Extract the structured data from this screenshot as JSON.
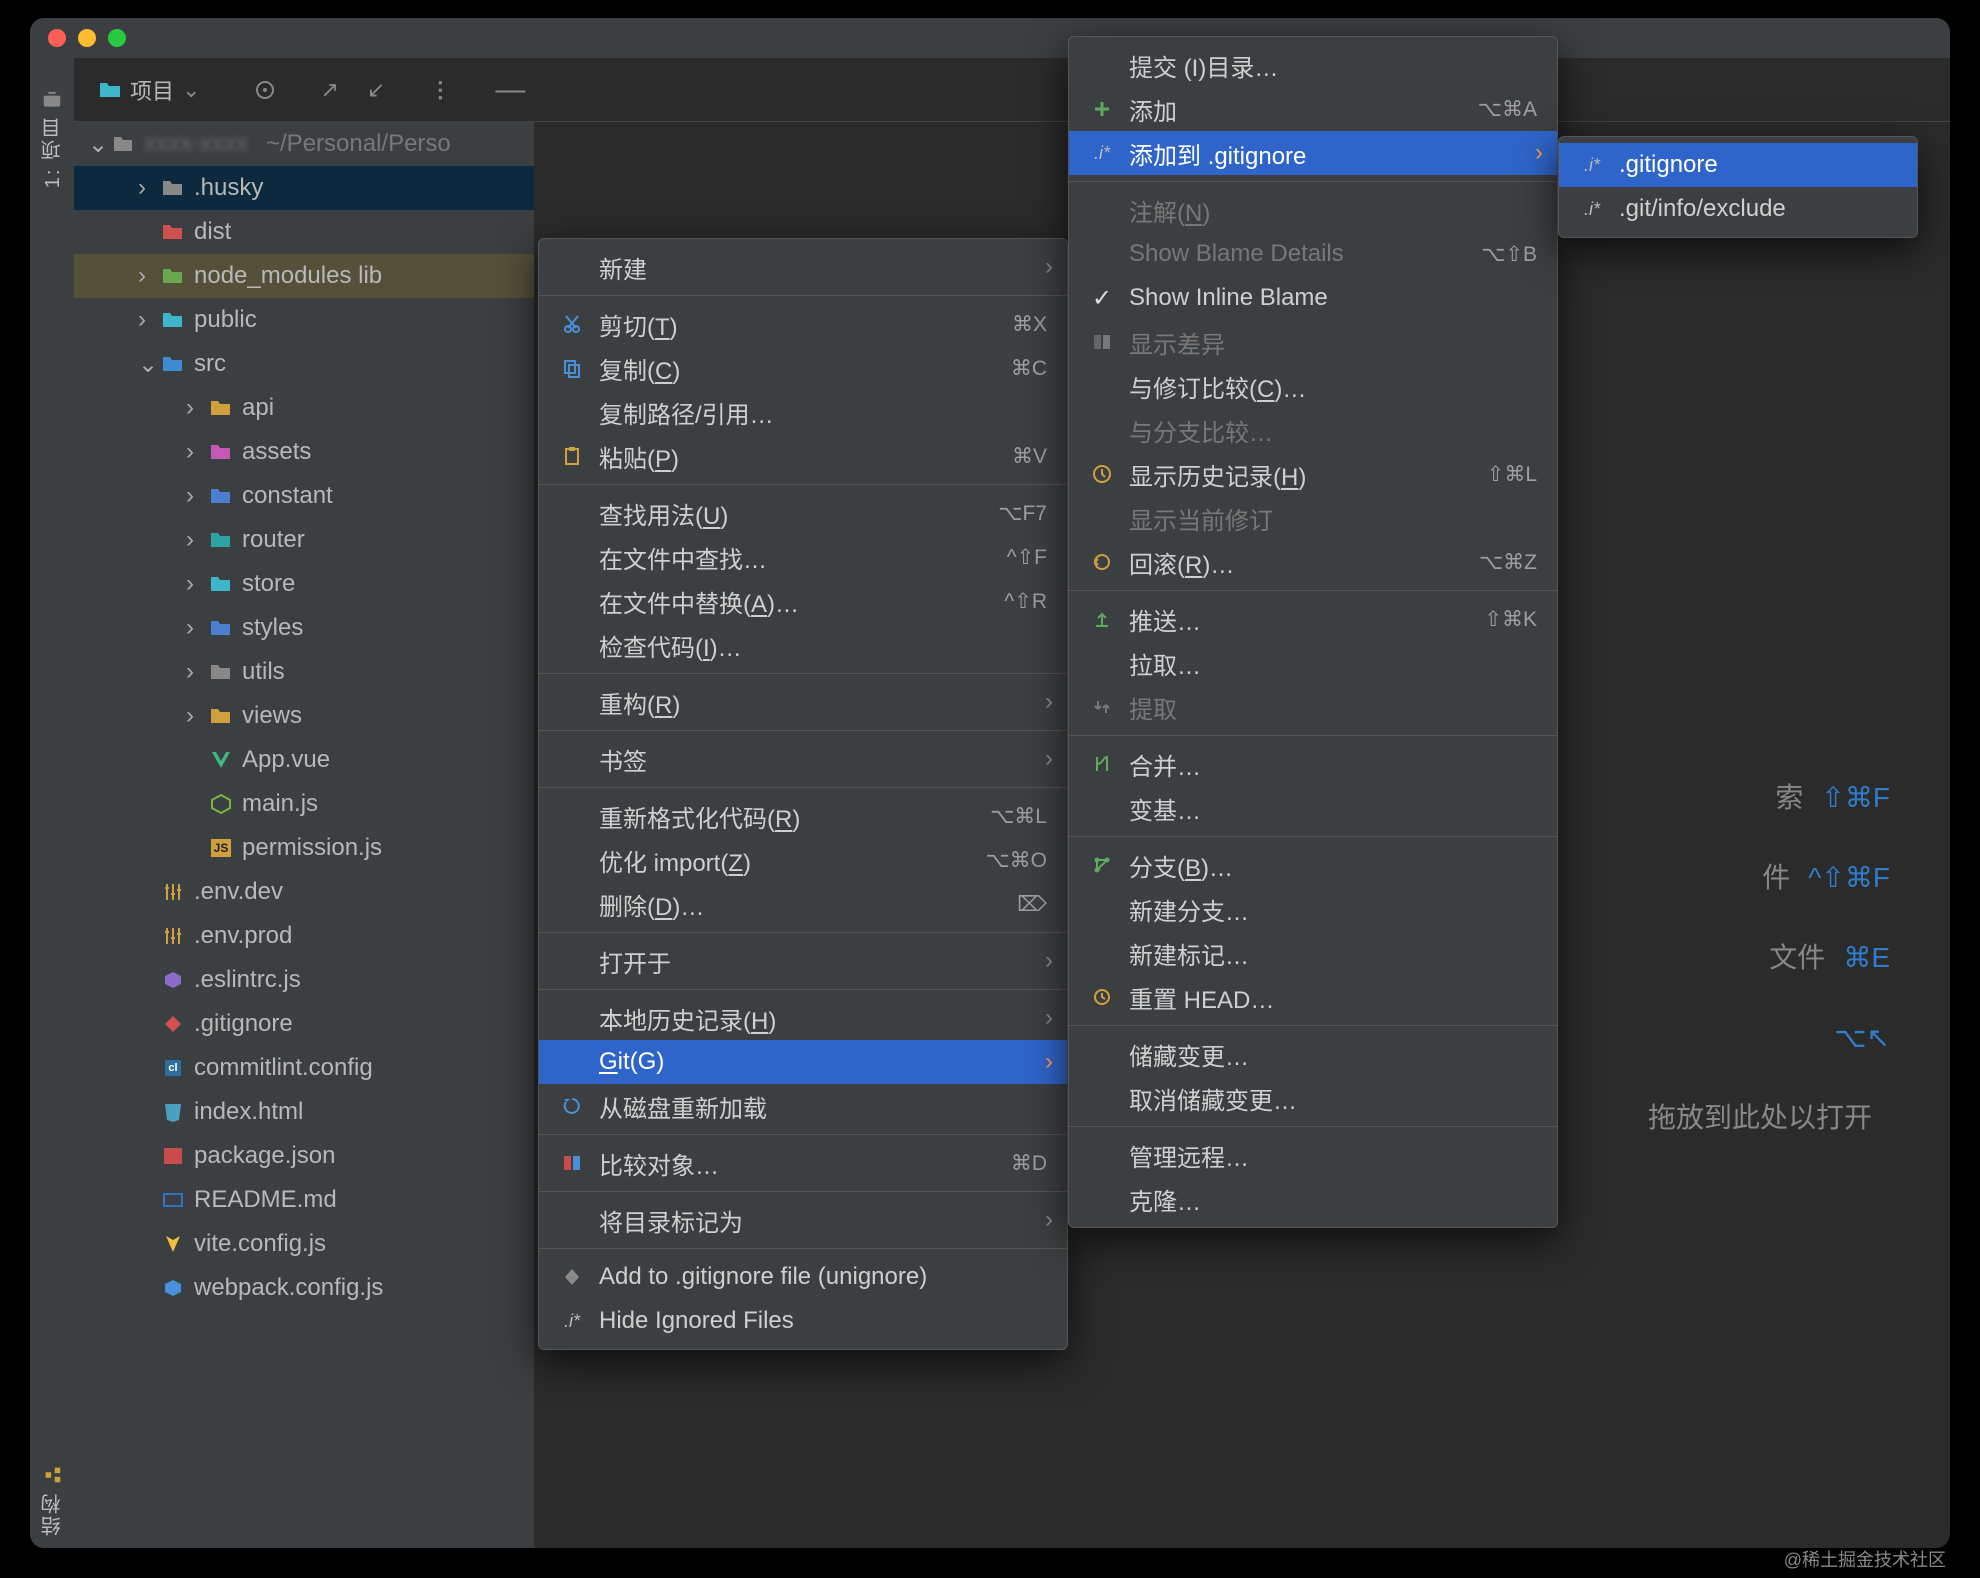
{
  "titlebar": {},
  "rail": {
    "top_label": "1: 项目",
    "bottom_label": "结构"
  },
  "toolbar": {
    "project_label": "项目"
  },
  "tree": {
    "root_path": "~/Personal/Perso",
    "nodes": [
      {
        "name": ".husky",
        "depth": 1,
        "chev": "›",
        "icon": "folder-gray",
        "sel": true
      },
      {
        "name": "dist",
        "depth": 1,
        "chev": "",
        "icon": "folder-red"
      },
      {
        "name": "node_modules  lib",
        "depth": 1,
        "chev": "›",
        "icon": "folder-green",
        "dim": true
      },
      {
        "name": "public",
        "depth": 1,
        "chev": "›",
        "icon": "folder-cyan"
      },
      {
        "name": "src",
        "depth": 1,
        "chev": "⌄",
        "icon": "folder-code"
      },
      {
        "name": "api",
        "depth": 2,
        "chev": "›",
        "icon": "folder-yellow"
      },
      {
        "name": "assets",
        "depth": 2,
        "chev": "›",
        "icon": "folder-magenta"
      },
      {
        "name": "constant",
        "depth": 2,
        "chev": "›",
        "icon": "folder-blue"
      },
      {
        "name": "router",
        "depth": 2,
        "chev": "›",
        "icon": "folder-teal"
      },
      {
        "name": "store",
        "depth": 2,
        "chev": "›",
        "icon": "folder-cyan"
      },
      {
        "name": "styles",
        "depth": 2,
        "chev": "›",
        "icon": "folder-blue"
      },
      {
        "name": "utils",
        "depth": 2,
        "chev": "›",
        "icon": "folder-gray"
      },
      {
        "name": "views",
        "depth": 2,
        "chev": "›",
        "icon": "folder-yellow"
      },
      {
        "name": "App.vue",
        "depth": 2,
        "chev": "",
        "icon": "vue"
      },
      {
        "name": "main.js",
        "depth": 2,
        "chev": "",
        "icon": "node"
      },
      {
        "name": "permission.js",
        "depth": 2,
        "chev": "",
        "icon": "js"
      },
      {
        "name": ".env.dev",
        "depth": 1,
        "chev": "",
        "icon": "env"
      },
      {
        "name": ".env.prod",
        "depth": 1,
        "chev": "",
        "icon": "env"
      },
      {
        "name": ".eslintrc.js",
        "depth": 1,
        "chev": "",
        "icon": "eslint"
      },
      {
        "name": ".gitignore",
        "depth": 1,
        "chev": "",
        "icon": "gitignore"
      },
      {
        "name": "commitlint.config",
        "depth": 1,
        "chev": "",
        "icon": "cl"
      },
      {
        "name": "index.html",
        "depth": 1,
        "chev": "",
        "icon": "html"
      },
      {
        "name": "package.json",
        "depth": 1,
        "chev": "",
        "icon": "pkg"
      },
      {
        "name": "README.md",
        "depth": 1,
        "chev": "",
        "icon": "md"
      },
      {
        "name": "vite.config.js",
        "depth": 1,
        "chev": "",
        "icon": "vite"
      },
      {
        "name": "webpack.config.js",
        "depth": 1,
        "chev": "",
        "icon": "webpack"
      }
    ]
  },
  "ctx1": {
    "items": [
      {
        "label": "新建",
        "icon": "",
        "submenu": true
      },
      {
        "sep": true
      },
      {
        "label": "剪切(T)",
        "icon": "cut",
        "shortcut": "⌘X",
        "uline": "T"
      },
      {
        "label": "复制(C)",
        "icon": "copy",
        "shortcut": "⌘C",
        "uline": "C"
      },
      {
        "label": "复制路径/引用…",
        "icon": ""
      },
      {
        "label": "粘贴(P)",
        "icon": "paste",
        "shortcut": "⌘V",
        "uline": "P"
      },
      {
        "sep": true
      },
      {
        "label": "查找用法(U)",
        "shortcut": "⌥F7",
        "uline": "U"
      },
      {
        "label": "在文件中查找…",
        "shortcut": "^⇧F"
      },
      {
        "label": "在文件中替换(A)…",
        "shortcut": "^⇧R",
        "uline": "A"
      },
      {
        "label": "检查代码(I)…",
        "uline": "I"
      },
      {
        "sep": true
      },
      {
        "label": "重构(R)",
        "submenu": true,
        "uline": "R"
      },
      {
        "sep": true
      },
      {
        "label": "书签",
        "submenu": true
      },
      {
        "sep": true
      },
      {
        "label": "重新格式化代码(R)",
        "shortcut": "⌥⌘L",
        "uline": "R"
      },
      {
        "label": "优化 import(Z)",
        "shortcut": "⌥⌘O",
        "uline": "Z"
      },
      {
        "label": "删除(D)…",
        "shortcut": "⌦",
        "uline": "D"
      },
      {
        "sep": true
      },
      {
        "label": "打开于",
        "submenu": true
      },
      {
        "sep": true
      },
      {
        "label": "本地历史记录(H)",
        "submenu": true,
        "uline": "H"
      },
      {
        "label": "Git(G)",
        "submenu": true,
        "hl": true,
        "uline": "G"
      },
      {
        "label": "从磁盘重新加载",
        "icon": "reload"
      },
      {
        "sep": true
      },
      {
        "label": "比较对象…",
        "icon": "diff",
        "shortcut": "⌘D"
      },
      {
        "sep": true
      },
      {
        "label": "将目录标记为",
        "submenu": true
      },
      {
        "sep": true
      },
      {
        "label": "Add to .gitignore file (unignore)",
        "icon": "gitignore"
      },
      {
        "label": "Hide Ignored Files",
        "icon": "istar"
      }
    ]
  },
  "ctx2": {
    "items": [
      {
        "label": "提交 (I)目录…"
      },
      {
        "label": "添加",
        "icon": "plus",
        "shortcut": "⌥⌘A"
      },
      {
        "label": "添加到 .gitignore",
        "icon": "istar",
        "submenu": true,
        "hl": true
      },
      {
        "sep": true
      },
      {
        "label": "注解(N)",
        "disabled": true,
        "uline": "N"
      },
      {
        "label": "Show Blame Details",
        "shortcut": "⌥⇧B",
        "disabled": true
      },
      {
        "label": "Show Inline Blame",
        "icon": "check"
      },
      {
        "label": "显示差异",
        "icon": "diff-gray",
        "disabled": true
      },
      {
        "label": "与修订比较(C)…",
        "uline": "C"
      },
      {
        "label": "与分支比较…",
        "disabled": true
      },
      {
        "label": "显示历史记录(H)",
        "icon": "clock",
        "shortcut": "⇧⌘L",
        "uline": "H"
      },
      {
        "label": "显示当前修订",
        "disabled": true
      },
      {
        "label": "回滚(R)…",
        "icon": "rollback",
        "shortcut": "⌥⌘Z",
        "uline": "R"
      },
      {
        "sep": true
      },
      {
        "label": "推送…",
        "icon": "push",
        "shortcut": "⇧⌘K"
      },
      {
        "label": "拉取…"
      },
      {
        "label": "提取",
        "icon": "fetch",
        "disabled": true
      },
      {
        "sep": true
      },
      {
        "label": "合并…",
        "icon": "merge"
      },
      {
        "label": "变基…"
      },
      {
        "sep": true
      },
      {
        "label": "分支(B)…",
        "icon": "branch",
        "uline": "B"
      },
      {
        "label": "新建分支…"
      },
      {
        "label": "新建标记…"
      },
      {
        "label": "重置 HEAD…",
        "icon": "reset"
      },
      {
        "sep": true
      },
      {
        "label": "储藏变更…"
      },
      {
        "label": "取消储藏变更…"
      },
      {
        "sep": true
      },
      {
        "label": "管理远程…"
      },
      {
        "label": "克隆…"
      }
    ]
  },
  "ctx3": {
    "items": [
      {
        "label": ".gitignore",
        "icon": "istar",
        "hl": true
      },
      {
        "label": ".git/info/exclude",
        "icon": "istar"
      }
    ]
  },
  "hints": {
    "rows": [
      {
        "tail": "索",
        "sc": "⇧⌘F"
      },
      {
        "tail": "件",
        "sc": "^⇧⌘F"
      },
      {
        "tail": "文件",
        "sc": "⌘E"
      },
      {
        "tail": "",
        "sc": "⌥↖"
      },
      {
        "tail": "拖放到此处以打开",
        "sc": ""
      }
    ]
  },
  "watermark": "@稀土掘金技术社区"
}
